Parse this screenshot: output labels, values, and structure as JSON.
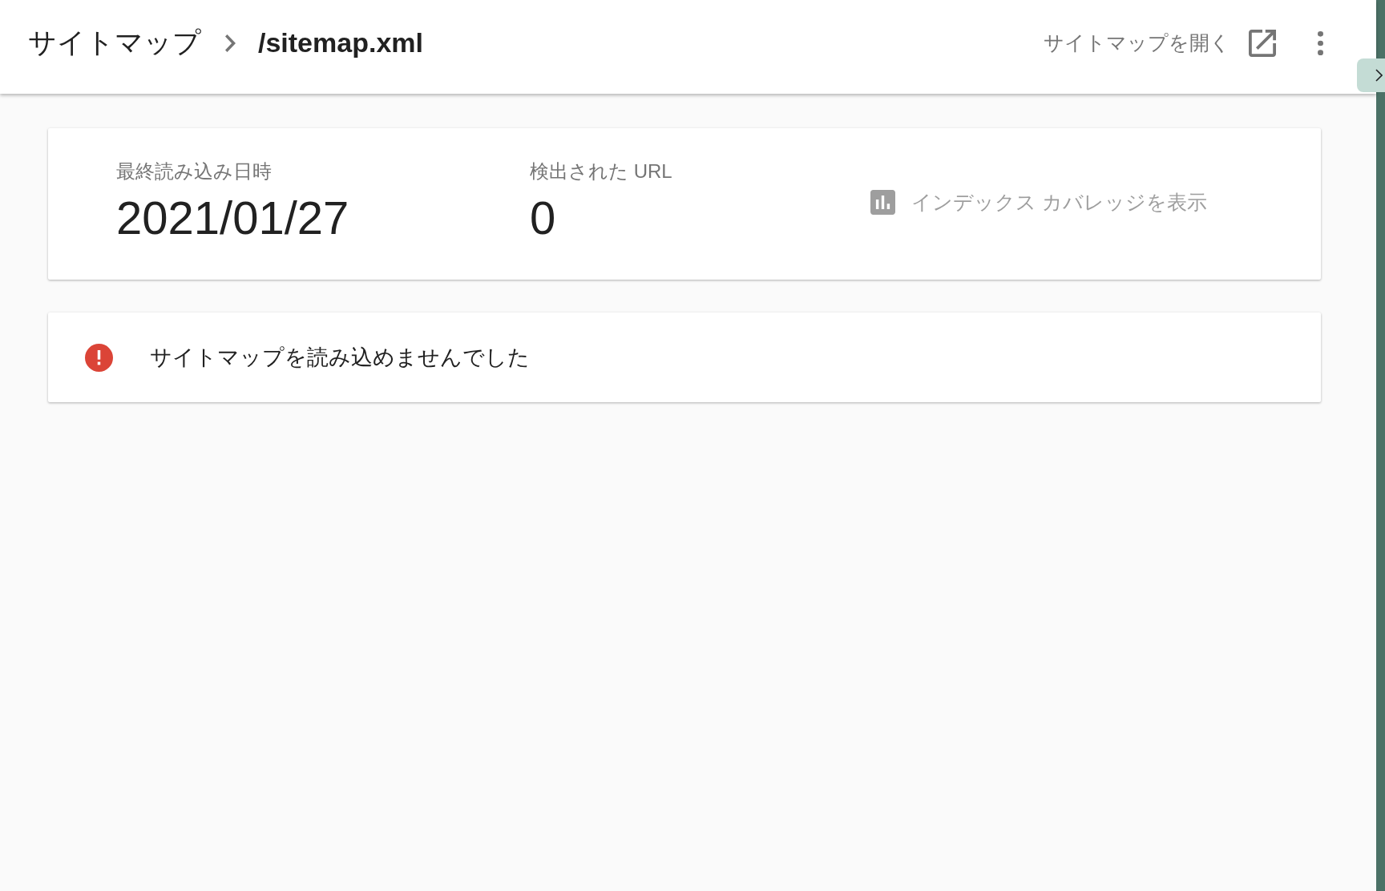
{
  "breadcrumb": {
    "parent": "サイトマップ",
    "current": "/sitemap.xml"
  },
  "header_actions": {
    "open_link": "サイトマップを開く"
  },
  "summary": {
    "stats": [
      {
        "label": "最終読み込み日時",
        "value": "2021/01/27"
      },
      {
        "label": "検出された URL",
        "value": "0"
      }
    ],
    "coverage_link": {
      "label": "インデックス カバレッジを表示",
      "disabled": true
    }
  },
  "alert": {
    "kind": "error",
    "message": "サイトマップを読み込めませんでした"
  }
}
